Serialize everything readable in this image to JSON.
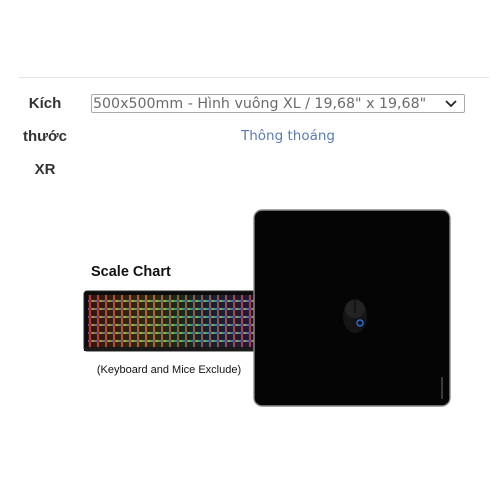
{
  "product_option": {
    "label_lines": [
      "Kích",
      "thước",
      "XR"
    ],
    "selected_value": "500x500mm - Hình vuông XL / 19,68\" x 19,68\"",
    "link_text": "Thông thoáng"
  },
  "image": {
    "scale_title": "Scale Chart",
    "scale_note": "(Keyboard and Mice Exclude)",
    "pad_color": "#050505",
    "mouse_logo_color": "#2a6dd8"
  },
  "icons": {
    "dropdown": "chevron-down-icon"
  }
}
